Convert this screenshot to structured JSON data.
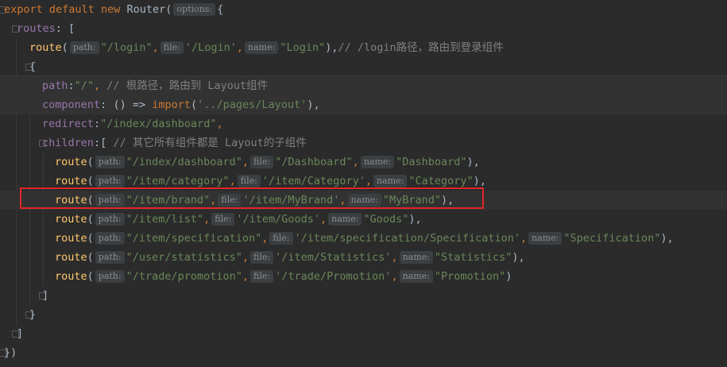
{
  "lines": {
    "l0": {
      "kw1": "export",
      "kw2": "default",
      "kw3": "new",
      "cls": "Router",
      "paren": "(",
      "hint": "options:",
      "brace": "{"
    },
    "l1": {
      "prop": "routes",
      "rest": ": ["
    },
    "l2": {
      "fn": "route",
      "open": "(",
      "h1": "path:",
      "s1": "\"/login\"",
      "c1": ",",
      "h2": "file:",
      "s2": "'/Login'",
      "c2": ",",
      "h3": "name:",
      "s3": "\"Login\"",
      "close": "),",
      "cmt": "// /login路径，路由到登录组件"
    },
    "l3": {
      "brace": "{"
    },
    "l4": {
      "prop": "path",
      "colon": ":",
      "str": "\"/\"",
      "comma": ",",
      "cmt": "// 根路径，路由到 Layout组件"
    },
    "l5": {
      "prop": "component",
      "colon": ":",
      "arrow": "() =>",
      "fn": "import",
      "open": "(",
      "str": "'../pages/Layout'",
      "close": "),"
    },
    "l6": {
      "prop": "redirect",
      "colon": ":",
      "str": "\"/index/dashboard\"",
      "comma": ","
    },
    "l7": {
      "prop": "children",
      "rest": ":[",
      "cmt": "// 其它所有组件都是 Layout的子组件"
    },
    "l8": {
      "fn": "route",
      "open": "(",
      "h1": "path:",
      "s1": "\"/index/dashboard\"",
      "c1": ",",
      "h2": "file:",
      "s2": "\"/Dashboard\"",
      "c2": ",",
      "h3": "name:",
      "s3": "\"Dashboard\"",
      "close": "),"
    },
    "l9": {
      "fn": "route",
      "open": "(",
      "h1": "path:",
      "s1": "\"/item/category\"",
      "c1": ",",
      "h2": "file:",
      "s2": "'/item/Category'",
      "c2": ",",
      "h3": "name:",
      "s3": "\"Category\"",
      "close": "),"
    },
    "l10": {
      "fn": "route",
      "open": "(",
      "h1": "path:",
      "s1": "\"/item/brand\"",
      "c1": ",",
      "h2": "file:",
      "s2": "'/item/MyBrand'",
      "c2": ",",
      "h3": "name:",
      "s3": "\"MyBrand\"",
      "close": "),"
    },
    "l11": {
      "fn": "route",
      "open": "(",
      "h1": "path:",
      "s1": "\"/item/list\"",
      "c1": ",",
      "h2": "file:",
      "s2": "'/item/Goods'",
      "c2": ",",
      "h3": "name:",
      "s3": "\"Goods\"",
      "close": "),"
    },
    "l12": {
      "fn": "route",
      "open": "(",
      "h1": "path:",
      "s1": "\"/item/specification\"",
      "c1": ",",
      "h2": "file:",
      "s2": "'/item/specification/Specification'",
      "c2": ",",
      "h3": "name:",
      "s3": "\"Specification\"",
      "close": "),"
    },
    "l13": {
      "fn": "route",
      "open": "(",
      "h1": "path:",
      "s1": "\"/user/statistics\"",
      "c1": ",",
      "h2": "file:",
      "s2": "'/item/Statistics'",
      "c2": ",",
      "h3": "name:",
      "s3": "\"Statistics\"",
      "close": "),"
    },
    "l14": {
      "fn": "route",
      "open": "(",
      "h1": "path:",
      "s1": "\"/trade/promotion\"",
      "c1": ",",
      "h2": "file:",
      "s2": "'/trade/Promotion'",
      "c2": ",",
      "h3": "name:",
      "s3": "\"Promotion\"",
      "close": ")"
    },
    "l15": {
      "text": "]"
    },
    "l16": {
      "text": "}"
    },
    "l17": {
      "text": "]"
    },
    "l18": {
      "text": "})"
    }
  },
  "colors": {
    "background": "#2b2b2b",
    "keyword": "#cc7832",
    "function": "#ffc66d",
    "string": "#6a8759",
    "comment": "#808080",
    "property": "#9876aa",
    "highlight_box": "#e0262a"
  }
}
